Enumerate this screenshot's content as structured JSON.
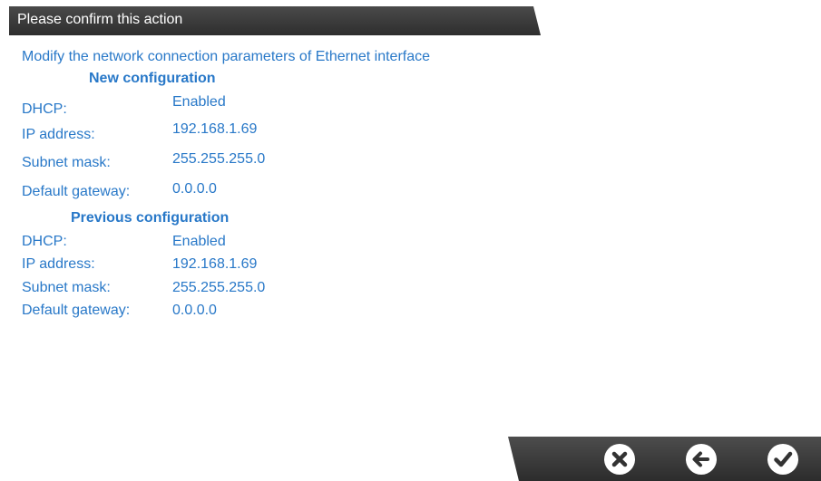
{
  "dialog": {
    "title": "Please confirm this action",
    "description": "Modify the network connection parameters of Ethernet interface"
  },
  "new_config": {
    "heading": "New configuration",
    "rows": [
      {
        "label": "DHCP:",
        "value": "Enabled"
      },
      {
        "label": "IP address:",
        "value": "192.168.1.69"
      },
      {
        "label": "Subnet mask:",
        "value": "255.255.255.0"
      },
      {
        "label": "Default gateway:",
        "value": "0.0.0.0"
      }
    ]
  },
  "previous_config": {
    "heading": "Previous configuration",
    "rows": [
      {
        "label": "DHCP:",
        "value": "Enabled"
      },
      {
        "label": "IP address:",
        "value": "192.168.1.69"
      },
      {
        "label": "Subnet mask:",
        "value": "255.255.255.0"
      },
      {
        "label": "Default gateway:",
        "value": "0.0.0.0"
      }
    ]
  },
  "actions": {
    "cancel_icon": "close-icon",
    "back_icon": "arrow-left-icon",
    "confirm_icon": "check-icon"
  },
  "colors": {
    "text_accent": "#2878c8",
    "bar_dark": "#3a3a3a"
  }
}
